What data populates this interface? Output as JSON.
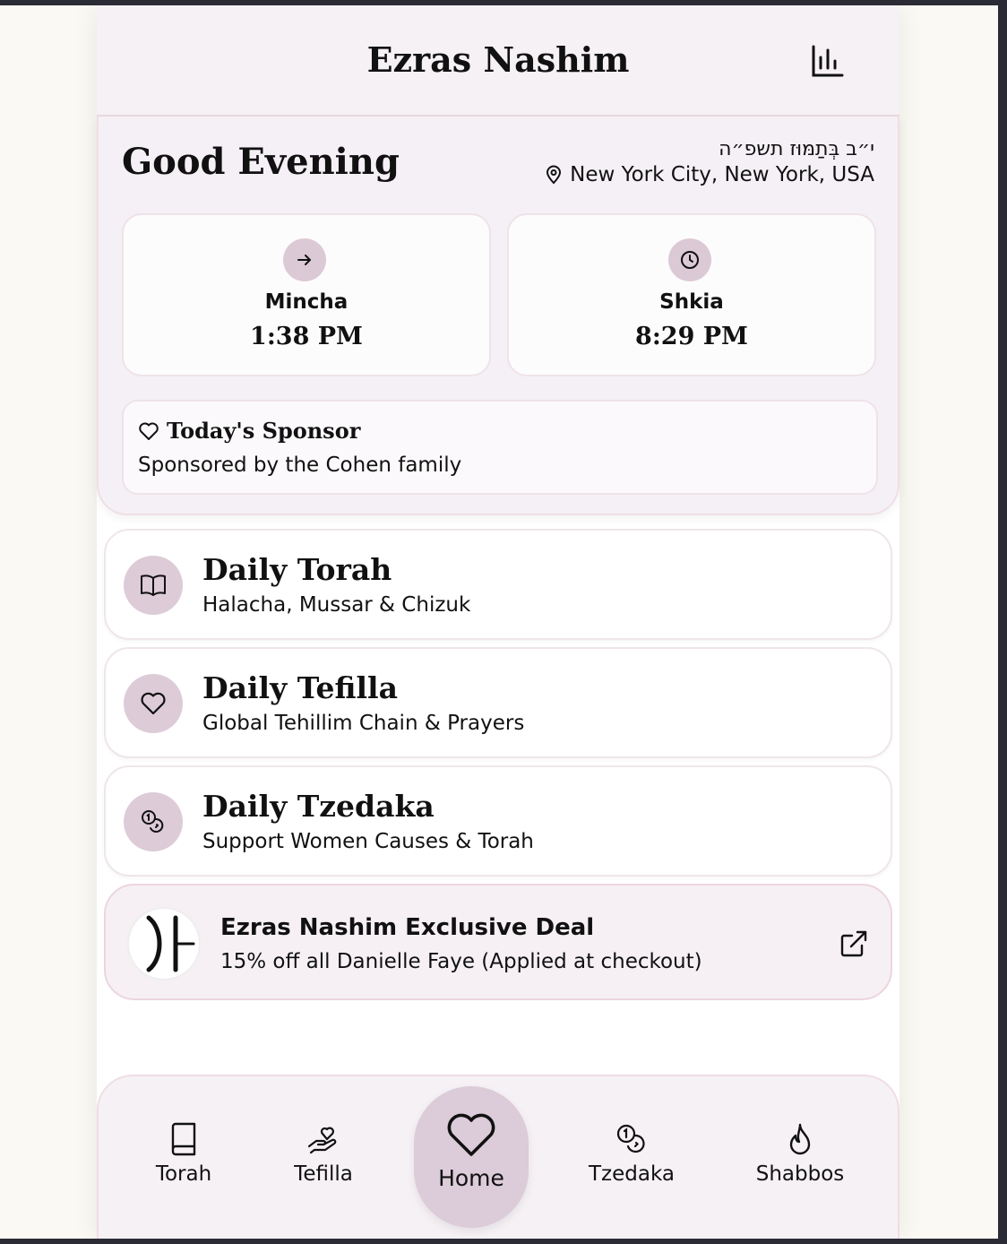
{
  "app": {
    "title": "Ezras Nashim",
    "stats_icon": "bar-chart-icon"
  },
  "greeting": {
    "text": "Good Evening",
    "hebrew_date": "י״ב בְּתַמּוּז תשפ״ה",
    "location": "New York City, New York, USA",
    "location_icon": "map-pin-icon"
  },
  "times": [
    {
      "label": "Mincha",
      "value": "1:38 PM",
      "icon": "arrow-right-icon"
    },
    {
      "label": "Shkia",
      "value": "8:29 PM",
      "icon": "clock-icon"
    }
  ],
  "sponsor": {
    "title": "Today's Sponsor",
    "text": "Sponsored by the Cohen family",
    "icon": "heart-icon"
  },
  "features": [
    {
      "title": "Daily Torah",
      "subtitle": "Halacha, Mussar & Chizuk",
      "icon": "book-open-icon"
    },
    {
      "title": "Daily Tefilla",
      "subtitle": "Global Tehillim Chain & Prayers",
      "icon": "heart-icon"
    },
    {
      "title": "Daily Tzedaka",
      "subtitle": "Support Women Causes & Torah",
      "icon": "coins-icon"
    }
  ],
  "deal": {
    "title": "Ezras Nashim Exclusive Deal",
    "subtitle": "15% off all Danielle Faye (Applied at checkout)",
    "icon": "external-link-icon"
  },
  "nav": {
    "torah": "Torah",
    "tefilla": "Tefilla",
    "home": "Home",
    "tzedaka": "Tzedaka",
    "shabbos": "Shabbos"
  },
  "colors": {
    "panel_bg": "#f5f0f5",
    "icon_circle": "#dcc9d6",
    "border_pink": "#ecd5df",
    "text": "#111111"
  }
}
